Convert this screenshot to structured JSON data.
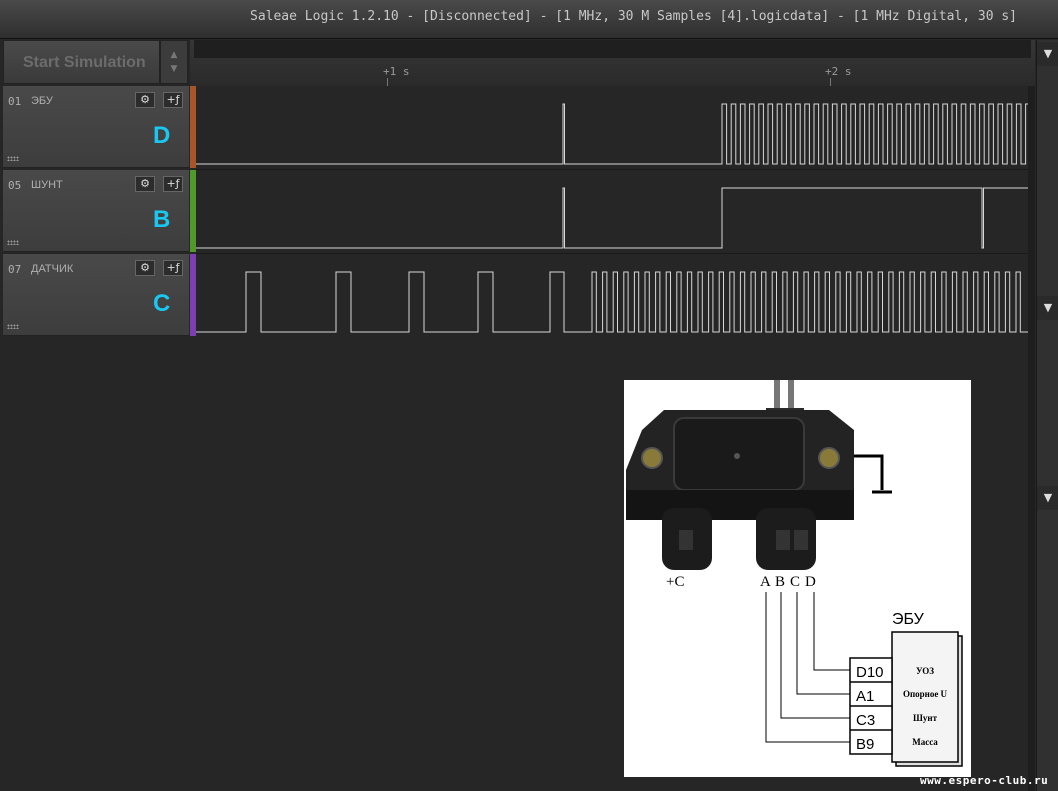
{
  "window": {
    "title": "Saleae Logic 1.2.10 - [Disconnected] - [1 MHz, 30 M Samples [4].logicdata] - [1 MHz Digital, 30 s]"
  },
  "toolbar": {
    "start_simulation_label": "Start Simulation"
  },
  "timeline": {
    "ticks": [
      {
        "label": "+1 s"
      },
      {
        "label": "+2 s"
      }
    ]
  },
  "channels": [
    {
      "number": "01",
      "name": "ЭБУ",
      "letter": "D",
      "color": "#a8552c"
    },
    {
      "number": "05",
      "name": "ШУНТ",
      "letter": "B",
      "color": "#4f9a2b"
    },
    {
      "number": "07",
      "name": "ДАТЧИК",
      "letter": "C",
      "color": "#7b3fb2"
    }
  ],
  "icons": {
    "settings": "gear-icon",
    "trigger": "trigger-edge-icon",
    "collapse": "triangle-down-icon"
  },
  "diagram": {
    "power_label": "+C",
    "pin_labels": [
      "A",
      "B",
      "C",
      "D"
    ],
    "ecu_title": "ЭБУ",
    "ecu_pins": [
      {
        "pin": "D10",
        "function": "УОЗ"
      },
      {
        "pin": "A1",
        "function": "Опорное U"
      },
      {
        "pin": "C3",
        "function": "Шунт"
      },
      {
        "pin": "B9",
        "function": "Масса"
      }
    ]
  },
  "watermark": "www.espero-club.ru"
}
